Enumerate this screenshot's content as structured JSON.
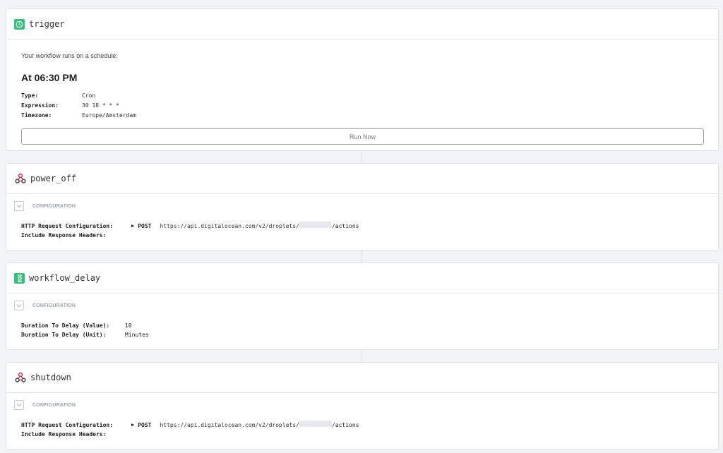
{
  "steps": {
    "trigger": {
      "title": "trigger",
      "icon": "clock-icon",
      "schedule_label": "Your workflow runs on a schedule:",
      "schedule_time": "At 06:30 PM",
      "fields": [
        {
          "key": "Type:",
          "value": "Cron"
        },
        {
          "key": "Expression:",
          "value": "30 18 * * *"
        },
        {
          "key": "Timezone:",
          "value": "Europe/Amsterdam"
        }
      ],
      "run_button": "Run Now"
    },
    "power_off": {
      "title": "power_off",
      "icon": "webhook-icon",
      "config_label": "CONFIGURATION",
      "http_key": "HTTP Request Configuration:",
      "method": "POST",
      "url_prefix": "https://api.digitalocean.com/v2/droplets/",
      "url_suffix": "/actions",
      "headers_key": "Include Response Headers:"
    },
    "workflow_delay": {
      "title": "workflow_delay",
      "icon": "hourglass-icon",
      "config_label": "CONFIGURATION",
      "fields": [
        {
          "key": "Duration To Delay (Value):",
          "value": "10"
        },
        {
          "key": "Duration To Delay (Unit):",
          "value": "Minutes"
        }
      ]
    },
    "shutdown": {
      "title": "shutdown",
      "icon": "webhook-icon",
      "config_label": "CONFIGURATION",
      "http_key": "HTTP Request Configuration:",
      "method": "POST",
      "url_prefix": "https://api.digitalocean.com/v2/droplets/",
      "url_suffix": "/actions",
      "headers_key": "Include Response Headers:"
    }
  },
  "colors": {
    "accent_green": "#3dbd7d",
    "webhook_red": "#c73a63"
  }
}
